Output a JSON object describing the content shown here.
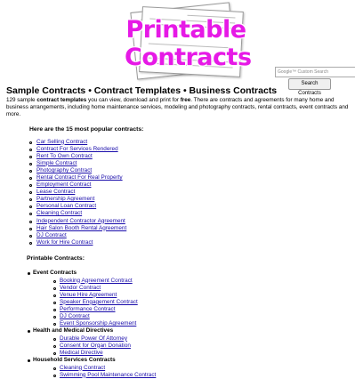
{
  "logo": {
    "line1": "Printable",
    "line2": "Contracts"
  },
  "search": {
    "placeholder": "Google™ Custom Search",
    "button_label": "Search Contracts"
  },
  "page_title": "Sample Contracts • Contract Templates • Business Contracts",
  "intro": {
    "part1": "129 sample ",
    "bold1": "contract templates",
    "part2": " you can view, download and print for ",
    "bold2": "free",
    "part3": ". There are contracts and agreements for many home and business arrangements, including home maintenance services, modeling and photography contracts, rental contracts, event contracts and more."
  },
  "popular_heading": "Here are the 15 most popular contracts:",
  "popular": [
    "Car Selling Contract",
    "Contract For Services Rendered",
    "Rent To Own Contract",
    "Simple Contract",
    "Photography Contract",
    "Rental Contract For Real Property",
    "Employment Contract",
    "Lease Contract",
    "Partnership Agreement",
    "Personal Loan Contract",
    "Cleaning Contract",
    "Independent Contractor Agreement",
    "Hair Salon Booth Rental Agreement",
    "DJ Contract",
    "Work for Hire Contract"
  ],
  "printable_heading": "Printable Contracts:",
  "categories": [
    {
      "name": "Event Contracts",
      "items": [
        "Booking Agreement Contract",
        "Vendor Contract",
        "Venue Hire Agreement",
        "Speaker Engagement Contract",
        "Performance Contract",
        "DJ Contract",
        "Event Sponsorship Agreement"
      ]
    },
    {
      "name": "Health and Medical Directives",
      "items": [
        "Durable Power Of Attorney",
        "Consent for Organ Donation",
        "Medical Directive"
      ]
    },
    {
      "name": "Household Services Contracts",
      "items": [
        "Cleaning Contract",
        "Swimming Pool Maintenance Contract"
      ]
    }
  ],
  "colors": {
    "logo_text": "#e619e6",
    "link": "#1a0dab"
  }
}
